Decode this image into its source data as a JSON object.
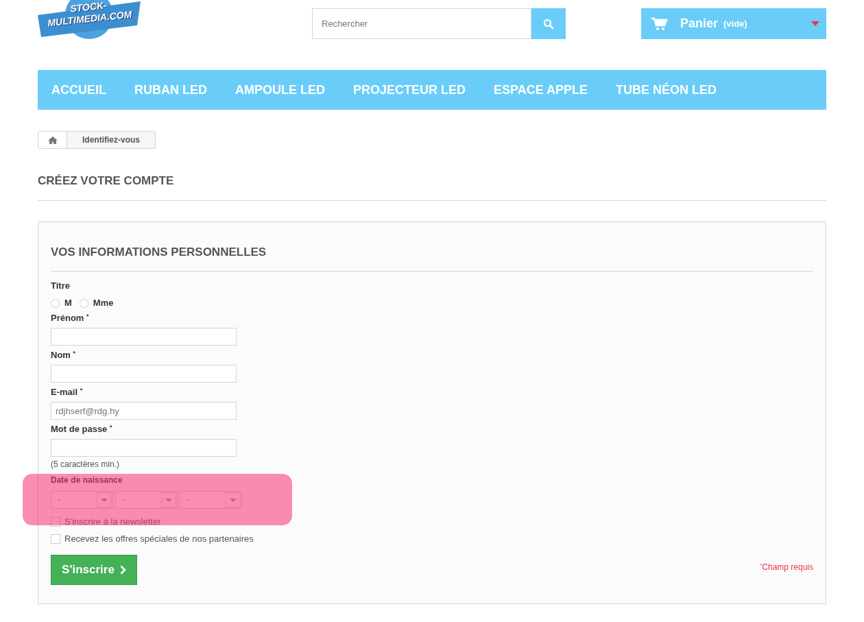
{
  "logo": {
    "lines": [
      "STOCK-",
      "MULTIMEDIA.COM"
    ]
  },
  "search": {
    "placeholder": "Rechercher"
  },
  "cart": {
    "label": "Panier",
    "status": "(vide)"
  },
  "nav": [
    {
      "label": "ACCUEIL"
    },
    {
      "label": "RUBAN LED"
    },
    {
      "label": "AMPOULE LED"
    },
    {
      "label": "PROJECTEUR LED"
    },
    {
      "label": "ESPACE APPLE"
    },
    {
      "label": "TUBE NÉON LED"
    }
  ],
  "breadcrumb": {
    "current": "Identifiez-vous"
  },
  "page_title": "CRÉEZ VOTRE COMPTE",
  "form": {
    "heading": "VOS INFORMATIONS PERSONNELLES",
    "title_label": "Titre",
    "title_options": [
      {
        "label": "M",
        "selected": false
      },
      {
        "label": "Mme",
        "selected": false
      }
    ],
    "fields": [
      {
        "label": "Prénom",
        "required_mark": "*"
      },
      {
        "label": "Nom",
        "required_mark": "*"
      },
      {
        "label": "E-mail",
        "required_mark": "*",
        "value": "rdjhserf@rdg.hy"
      },
      {
        "label": "Mot de passe",
        "required_mark": "*",
        "hint": "(5 caractères min.)"
      }
    ],
    "birthdate": {
      "label": "Date de naissance",
      "highlighted": true,
      "selects": [
        {
          "value": "-"
        },
        {
          "value": "-"
        },
        {
          "value": "-"
        }
      ]
    },
    "checkboxes": [
      {
        "label": "S'inscrire à la newsletter",
        "checked": false
      },
      {
        "label": "Recevez les offres spéciales de nos partenaires",
        "checked": false
      }
    ],
    "submit": "S'inscrire",
    "required_note": {
      "mark": "*",
      "text": "Champ requis"
    }
  }
}
